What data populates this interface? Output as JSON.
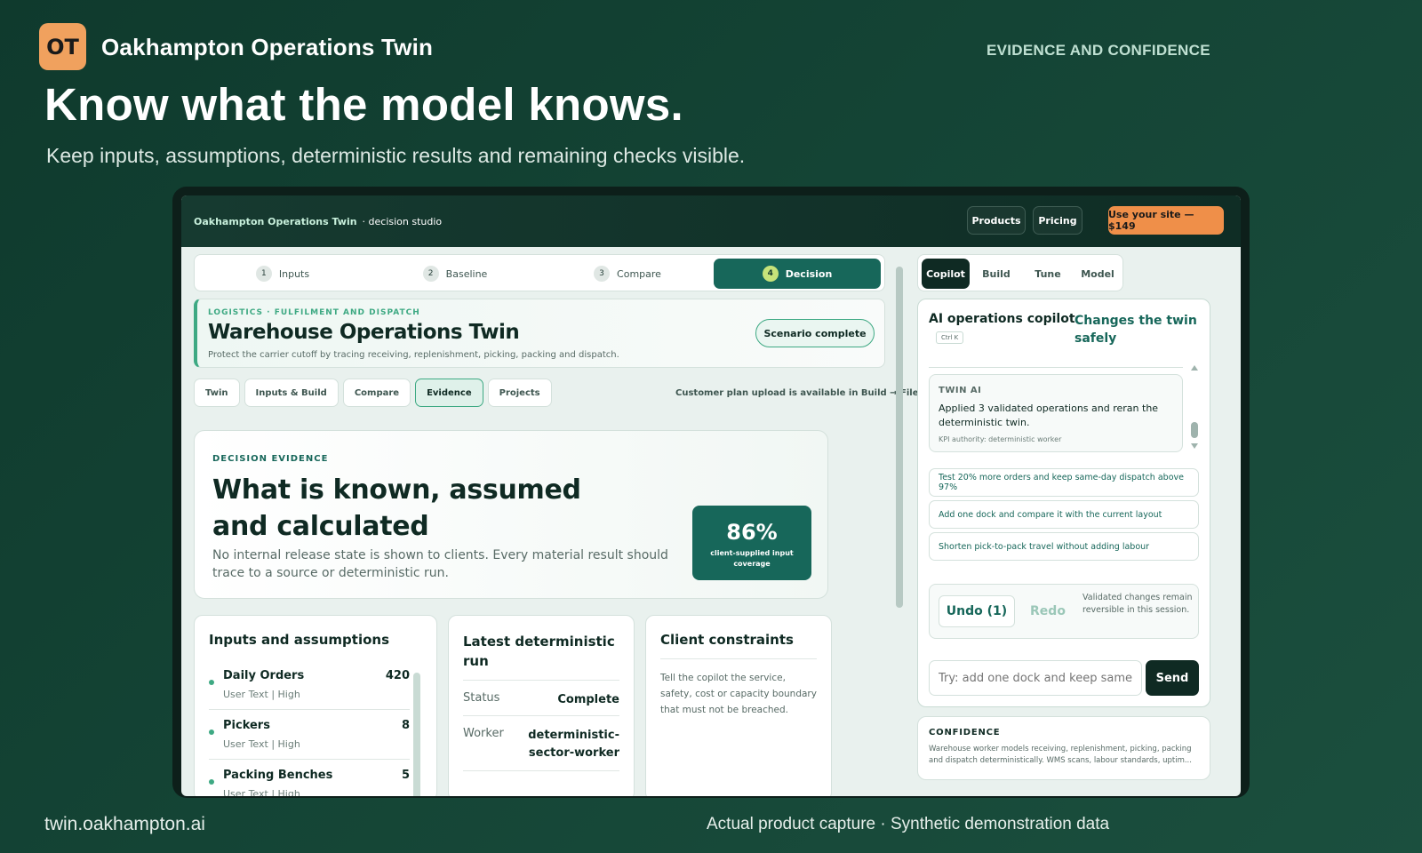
{
  "brand": {
    "logo": "OT",
    "name": "Oakhampton Operations Twin",
    "eyebrow": "EVIDENCE AND CONFIDENCE"
  },
  "hero": {
    "headline": "Know what the model knows.",
    "subheadline": "Keep inputs, assumptions, deterministic results and remaining checks visible."
  },
  "footer": {
    "url": "twin.oakhampton.ai",
    "note": "Actual product capture · Synthetic demonstration data"
  },
  "app": {
    "title": "Oakhampton Operations Twin",
    "subtitle": "· decision studio",
    "nav": {
      "products": "Products",
      "pricing": "Pricing",
      "cta": "Use your site — $149"
    },
    "steps": [
      {
        "num": "1",
        "label": "Inputs"
      },
      {
        "num": "2",
        "label": "Baseline"
      },
      {
        "num": "3",
        "label": "Compare"
      },
      {
        "num": "4",
        "label": "Decision"
      }
    ],
    "header": {
      "category": "LOGISTICS · FULFILMENT AND DISPATCH",
      "title": "Warehouse Operations Twin",
      "description": "Protect the carrier cutoff by tracing receiving, replenishment, picking, packing and dispatch.",
      "badge": "Scenario complete"
    },
    "tabs": [
      "Twin",
      "Inputs & Build",
      "Compare",
      "Evidence",
      "Projects"
    ],
    "upload_note": "Customer plan upload is available in Build → Files",
    "evidence": {
      "label": "DECISION EVIDENCE",
      "title": "What is known, assumed and calculated",
      "text": "No internal release state is shown to clients. Every material result should trace to a source or deterministic run.",
      "coverage_pct": "86%",
      "coverage_label": "client-supplied input coverage"
    },
    "inputs_card": {
      "title": "Inputs and assumptions",
      "rows": [
        {
          "name": "Daily Orders",
          "value": "420",
          "meta": "User Text | High"
        },
        {
          "name": "Pickers",
          "value": "8",
          "meta": "User Text | High"
        },
        {
          "name": "Packing Benches",
          "value": "5",
          "meta": "User Text | High"
        }
      ]
    },
    "run_card": {
      "title": "Latest deterministic run",
      "rows": [
        {
          "key": "Status",
          "value": "Complete"
        },
        {
          "key": "Worker",
          "value": "deterministic-sector-worker"
        }
      ]
    },
    "constraints_card": {
      "title": "Client constraints",
      "text": "Tell the copilot the service, safety, cost or capacity boundary that must not be breached."
    },
    "right_tabs": [
      "Copilot",
      "Build",
      "Tune",
      "Model"
    ],
    "copilot": {
      "title": "AI operations copilot",
      "shortcut": "Ctrl K",
      "tagline": "Changes the twin safely",
      "ai_label": "TWIN AI",
      "ai_message": "Applied 3 validated operations and reran the deterministic twin.",
      "ai_authority": "KPI authority: deterministic worker",
      "suggestions": [
        "Test 20% more orders and keep same-day dispatch above 97%",
        "Add one dock and compare it with the current layout",
        "Shorten pick-to-pack travel without adding labour"
      ],
      "undo": "Undo (1)",
      "redo": "Redo",
      "undo_note": "Validated changes remain reversible in this session.",
      "input_placeholder": "Try: add one dock and keep same",
      "send": "Send"
    },
    "confidence": {
      "label": "CONFIDENCE",
      "text": "Warehouse worker models receiving, replenishment, picking, packing and dispatch deterministically. WMS scans, labour standards, uptim..."
    }
  }
}
